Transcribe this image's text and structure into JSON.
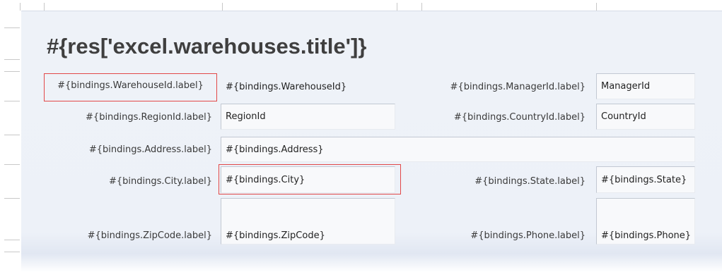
{
  "sheet": {
    "title": "#{res['excel.warehouses.title']}"
  },
  "form": {
    "warehouse_id_label": "#{bindings.WarehouseId.label}",
    "warehouse_id_value": "#{bindings.WarehouseId}",
    "manager_id_label": "#{bindings.ManagerId.label}",
    "manager_id_value": "ManagerId",
    "region_id_label": "#{bindings.RegionId.label}",
    "region_id_value": "RegionId",
    "country_id_label": "#{bindings.CountryId.label}",
    "country_id_value": "CountryId",
    "address_label": "#{bindings.Address.label}",
    "address_value": "#{bindings.Address}",
    "city_label": "#{bindings.City.label}",
    "city_value": "#{bindings.City}",
    "state_label": "#{bindings.State.label}",
    "state_value": "#{bindings.State}",
    "zipcode_label": "#{bindings.ZipCode.label}",
    "zipcode_value": "#{bindings.ZipCode}",
    "phone_label": "#{bindings.Phone.label}",
    "phone_value": "#{bindings.Phone}"
  },
  "colors": {
    "panel_background": "#edf1f8",
    "selection_border": "#e24848",
    "field_background": "#f8f9fb"
  }
}
